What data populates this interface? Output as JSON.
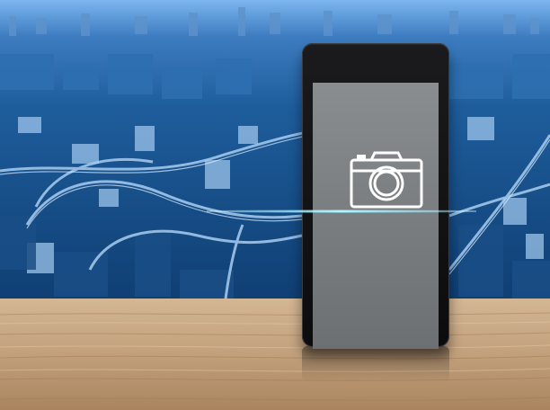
{
  "image": {
    "subject": "smartphone-on-wooden-table",
    "screen_icon": "camera-icon",
    "colors": {
      "sky_blue": "#5f9fe0",
      "city_blue": "#1f5a96",
      "wood": "#c7a886",
      "phone_body": "#141416",
      "screen_gray": "#7f8285",
      "glow": "#36d7ff"
    }
  }
}
